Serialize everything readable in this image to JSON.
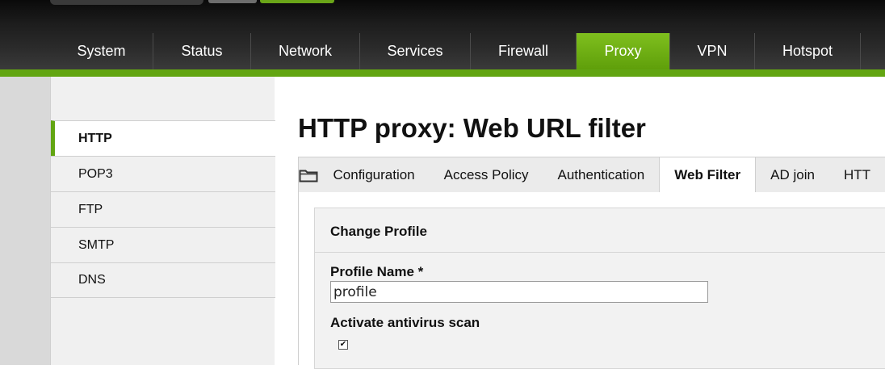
{
  "nav": {
    "items": [
      {
        "label": "System",
        "active": false
      },
      {
        "label": "Status",
        "active": false
      },
      {
        "label": "Network",
        "active": false
      },
      {
        "label": "Services",
        "active": false
      },
      {
        "label": "Firewall",
        "active": false
      },
      {
        "label": "Proxy",
        "active": true
      },
      {
        "label": "VPN",
        "active": false
      },
      {
        "label": "Hotspot",
        "active": false
      }
    ]
  },
  "sidebar": {
    "items": [
      {
        "label": "HTTP",
        "active": true
      },
      {
        "label": "POP3",
        "active": false
      },
      {
        "label": "FTP",
        "active": false
      },
      {
        "label": "SMTP",
        "active": false
      },
      {
        "label": "DNS",
        "active": false
      }
    ]
  },
  "page": {
    "title": "HTTP proxy: Web URL filter"
  },
  "tabs": {
    "icon": "folder-icon",
    "items": [
      {
        "label": "Configuration",
        "active": false
      },
      {
        "label": "Access Policy",
        "active": false
      },
      {
        "label": "Authentication",
        "active": false
      },
      {
        "label": "Web Filter",
        "active": true
      },
      {
        "label": "AD join",
        "active": false
      },
      {
        "label": "HTT",
        "active": false
      }
    ]
  },
  "form": {
    "section_title": "Change Profile",
    "profile_name_label": "Profile Name *",
    "profile_name_value": "profile",
    "antivirus_label": "Activate antivirus scan",
    "antivirus_checked": true
  },
  "colors": {
    "accent": "#62a512",
    "header_dark": "#2b2b2b",
    "panel_bg": "#f2f2f2"
  }
}
